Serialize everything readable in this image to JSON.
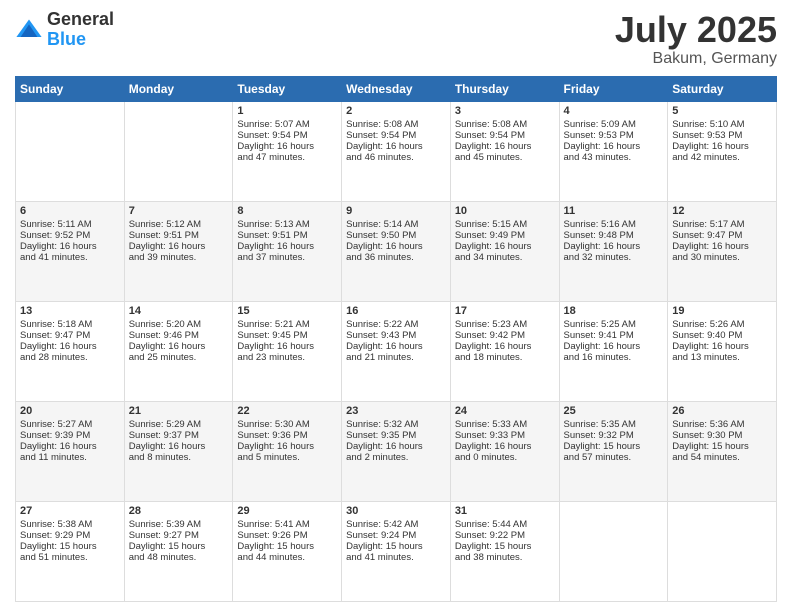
{
  "header": {
    "logo": {
      "general": "General",
      "blue": "Blue"
    },
    "title": "July 2025",
    "subtitle": "Bakum, Germany"
  },
  "calendar": {
    "headers": [
      "Sunday",
      "Monday",
      "Tuesday",
      "Wednesday",
      "Thursday",
      "Friday",
      "Saturday"
    ],
    "rows": [
      [
        {
          "day": "",
          "lines": []
        },
        {
          "day": "",
          "lines": []
        },
        {
          "day": "1",
          "lines": [
            "Sunrise: 5:07 AM",
            "Sunset: 9:54 PM",
            "Daylight: 16 hours",
            "and 47 minutes."
          ]
        },
        {
          "day": "2",
          "lines": [
            "Sunrise: 5:08 AM",
            "Sunset: 9:54 PM",
            "Daylight: 16 hours",
            "and 46 minutes."
          ]
        },
        {
          "day": "3",
          "lines": [
            "Sunrise: 5:08 AM",
            "Sunset: 9:54 PM",
            "Daylight: 16 hours",
            "and 45 minutes."
          ]
        },
        {
          "day": "4",
          "lines": [
            "Sunrise: 5:09 AM",
            "Sunset: 9:53 PM",
            "Daylight: 16 hours",
            "and 43 minutes."
          ]
        },
        {
          "day": "5",
          "lines": [
            "Sunrise: 5:10 AM",
            "Sunset: 9:53 PM",
            "Daylight: 16 hours",
            "and 42 minutes."
          ]
        }
      ],
      [
        {
          "day": "6",
          "lines": [
            "Sunrise: 5:11 AM",
            "Sunset: 9:52 PM",
            "Daylight: 16 hours",
            "and 41 minutes."
          ]
        },
        {
          "day": "7",
          "lines": [
            "Sunrise: 5:12 AM",
            "Sunset: 9:51 PM",
            "Daylight: 16 hours",
            "and 39 minutes."
          ]
        },
        {
          "day": "8",
          "lines": [
            "Sunrise: 5:13 AM",
            "Sunset: 9:51 PM",
            "Daylight: 16 hours",
            "and 37 minutes."
          ]
        },
        {
          "day": "9",
          "lines": [
            "Sunrise: 5:14 AM",
            "Sunset: 9:50 PM",
            "Daylight: 16 hours",
            "and 36 minutes."
          ]
        },
        {
          "day": "10",
          "lines": [
            "Sunrise: 5:15 AM",
            "Sunset: 9:49 PM",
            "Daylight: 16 hours",
            "and 34 minutes."
          ]
        },
        {
          "day": "11",
          "lines": [
            "Sunrise: 5:16 AM",
            "Sunset: 9:48 PM",
            "Daylight: 16 hours",
            "and 32 minutes."
          ]
        },
        {
          "day": "12",
          "lines": [
            "Sunrise: 5:17 AM",
            "Sunset: 9:47 PM",
            "Daylight: 16 hours",
            "and 30 minutes."
          ]
        }
      ],
      [
        {
          "day": "13",
          "lines": [
            "Sunrise: 5:18 AM",
            "Sunset: 9:47 PM",
            "Daylight: 16 hours",
            "and 28 minutes."
          ]
        },
        {
          "day": "14",
          "lines": [
            "Sunrise: 5:20 AM",
            "Sunset: 9:46 PM",
            "Daylight: 16 hours",
            "and 25 minutes."
          ]
        },
        {
          "day": "15",
          "lines": [
            "Sunrise: 5:21 AM",
            "Sunset: 9:45 PM",
            "Daylight: 16 hours",
            "and 23 minutes."
          ]
        },
        {
          "day": "16",
          "lines": [
            "Sunrise: 5:22 AM",
            "Sunset: 9:43 PM",
            "Daylight: 16 hours",
            "and 21 minutes."
          ]
        },
        {
          "day": "17",
          "lines": [
            "Sunrise: 5:23 AM",
            "Sunset: 9:42 PM",
            "Daylight: 16 hours",
            "and 18 minutes."
          ]
        },
        {
          "day": "18",
          "lines": [
            "Sunrise: 5:25 AM",
            "Sunset: 9:41 PM",
            "Daylight: 16 hours",
            "and 16 minutes."
          ]
        },
        {
          "day": "19",
          "lines": [
            "Sunrise: 5:26 AM",
            "Sunset: 9:40 PM",
            "Daylight: 16 hours",
            "and 13 minutes."
          ]
        }
      ],
      [
        {
          "day": "20",
          "lines": [
            "Sunrise: 5:27 AM",
            "Sunset: 9:39 PM",
            "Daylight: 16 hours",
            "and 11 minutes."
          ]
        },
        {
          "day": "21",
          "lines": [
            "Sunrise: 5:29 AM",
            "Sunset: 9:37 PM",
            "Daylight: 16 hours",
            "and 8 minutes."
          ]
        },
        {
          "day": "22",
          "lines": [
            "Sunrise: 5:30 AM",
            "Sunset: 9:36 PM",
            "Daylight: 16 hours",
            "and 5 minutes."
          ]
        },
        {
          "day": "23",
          "lines": [
            "Sunrise: 5:32 AM",
            "Sunset: 9:35 PM",
            "Daylight: 16 hours",
            "and 2 minutes."
          ]
        },
        {
          "day": "24",
          "lines": [
            "Sunrise: 5:33 AM",
            "Sunset: 9:33 PM",
            "Daylight: 16 hours",
            "and 0 minutes."
          ]
        },
        {
          "day": "25",
          "lines": [
            "Sunrise: 5:35 AM",
            "Sunset: 9:32 PM",
            "Daylight: 15 hours",
            "and 57 minutes."
          ]
        },
        {
          "day": "26",
          "lines": [
            "Sunrise: 5:36 AM",
            "Sunset: 9:30 PM",
            "Daylight: 15 hours",
            "and 54 minutes."
          ]
        }
      ],
      [
        {
          "day": "27",
          "lines": [
            "Sunrise: 5:38 AM",
            "Sunset: 9:29 PM",
            "Daylight: 15 hours",
            "and 51 minutes."
          ]
        },
        {
          "day": "28",
          "lines": [
            "Sunrise: 5:39 AM",
            "Sunset: 9:27 PM",
            "Daylight: 15 hours",
            "and 48 minutes."
          ]
        },
        {
          "day": "29",
          "lines": [
            "Sunrise: 5:41 AM",
            "Sunset: 9:26 PM",
            "Daylight: 15 hours",
            "and 44 minutes."
          ]
        },
        {
          "day": "30",
          "lines": [
            "Sunrise: 5:42 AM",
            "Sunset: 9:24 PM",
            "Daylight: 15 hours",
            "and 41 minutes."
          ]
        },
        {
          "day": "31",
          "lines": [
            "Sunrise: 5:44 AM",
            "Sunset: 9:22 PM",
            "Daylight: 15 hours",
            "and 38 minutes."
          ]
        },
        {
          "day": "",
          "lines": []
        },
        {
          "day": "",
          "lines": []
        }
      ]
    ]
  }
}
